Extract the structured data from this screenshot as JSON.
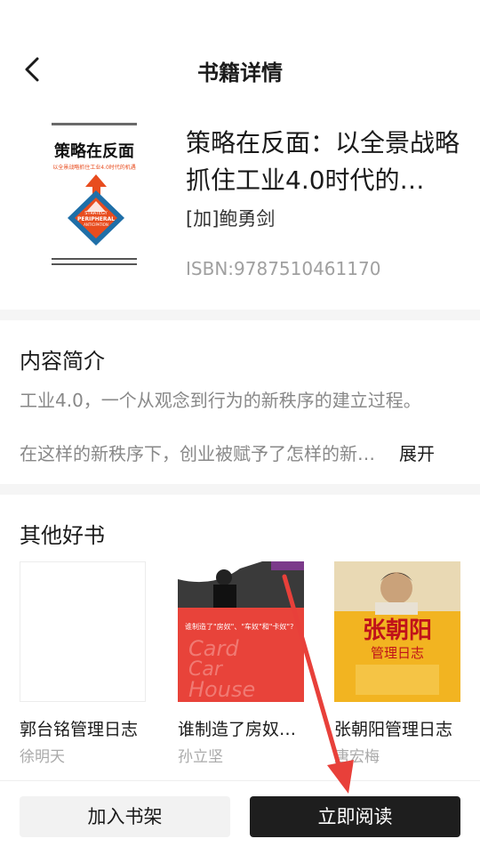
{
  "header": {
    "title": "书籍详情",
    "back_icon": "chevron-left-icon"
  },
  "book": {
    "title": "策略在反面：以全景战略抓住工业4.0时代的…",
    "author": "[加]鲍勇剑",
    "isbn": "ISBN:9787510461170",
    "cover": {
      "top_text": "以全景战略抓住工业4.0时代的机遇",
      "main_title": "策略在反面",
      "badge_en_1": "STRATEGY",
      "badge_en_2": "PERIPHERAL",
      "badge_en_3": "ANTICIPATION",
      "accent_color": "#e84c1e",
      "diamond_color": "#1f6fa8"
    }
  },
  "intro": {
    "title": "内容简介",
    "line1": "工业4.0，一个从观念到行为的新秩序的建立过程。",
    "line2": "在这样的新秩序下，创业被赋予了怎样的新…",
    "expand_label": "展开"
  },
  "recommend": {
    "title": "其他好书",
    "items": [
      {
        "title": "郭台铭管理日志",
        "author": "徐明天"
      },
      {
        "title": "谁制造了房奴…",
        "author": "孙立坚",
        "cover_text_1": "谁制造了\"房奴\"、\"车奴\"和\"卡奴\"?",
        "cover_text_2": "Card",
        "cover_text_3": "Car",
        "cover_text_4": "House",
        "cover_color": "#e8433a"
      },
      {
        "title": "张朝阳管理日志",
        "author": "唐宏梅",
        "cover_text_1": "张朝阳",
        "cover_text_2": "管理日志",
        "cover_color": "#f2b421"
      }
    ]
  },
  "actions": {
    "add_shelf": "加入书架",
    "read_now": "立即阅读"
  },
  "annotation": {
    "arrow_color": "#e8403a"
  }
}
